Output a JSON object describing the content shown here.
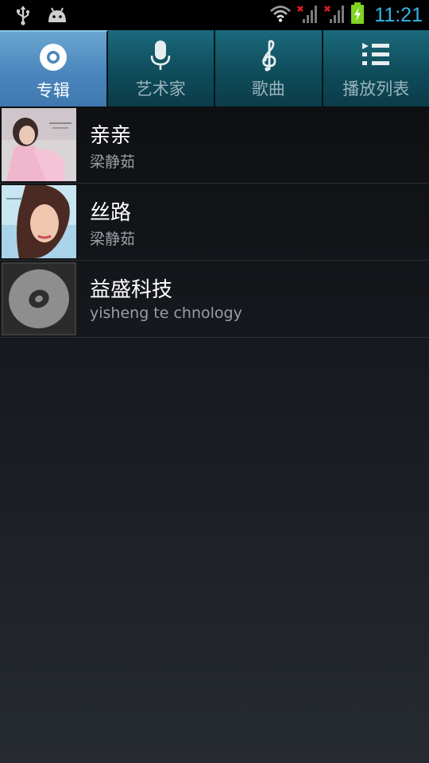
{
  "status_bar": {
    "time": "11:21",
    "icons": [
      "usb-icon",
      "android-icon",
      "wifi-icon",
      "signal-no-service-icon",
      "signal-no-service-icon",
      "battery-charging-icon"
    ],
    "colors": {
      "clock": "#35b6ea",
      "battery": "#7fd321",
      "no_signal_x": "#e01e1e"
    }
  },
  "tabs": [
    {
      "label": "专辑",
      "icon": "album-disc-icon",
      "active": true
    },
    {
      "label": "艺术家",
      "icon": "microphone-icon",
      "active": false
    },
    {
      "label": "歌曲",
      "icon": "treble-clef-icon",
      "active": false
    },
    {
      "label": "播放列表",
      "icon": "playlist-icon",
      "active": false
    }
  ],
  "albums": [
    {
      "title": "亲亲",
      "artist": "梁静茹",
      "cover": "album-cover-photo"
    },
    {
      "title": "丝路",
      "artist": "梁静茹",
      "cover": "album-cover-photo"
    },
    {
      "title": "益盛科技",
      "artist": "yisheng te chnology",
      "cover": "default-disc-icon"
    }
  ],
  "colors": {
    "active_tab": "#4b86bd",
    "inactive_tab": "#0f4c5b",
    "title_text": "#ffffff",
    "subtitle_text": "#9a9ea4"
  }
}
